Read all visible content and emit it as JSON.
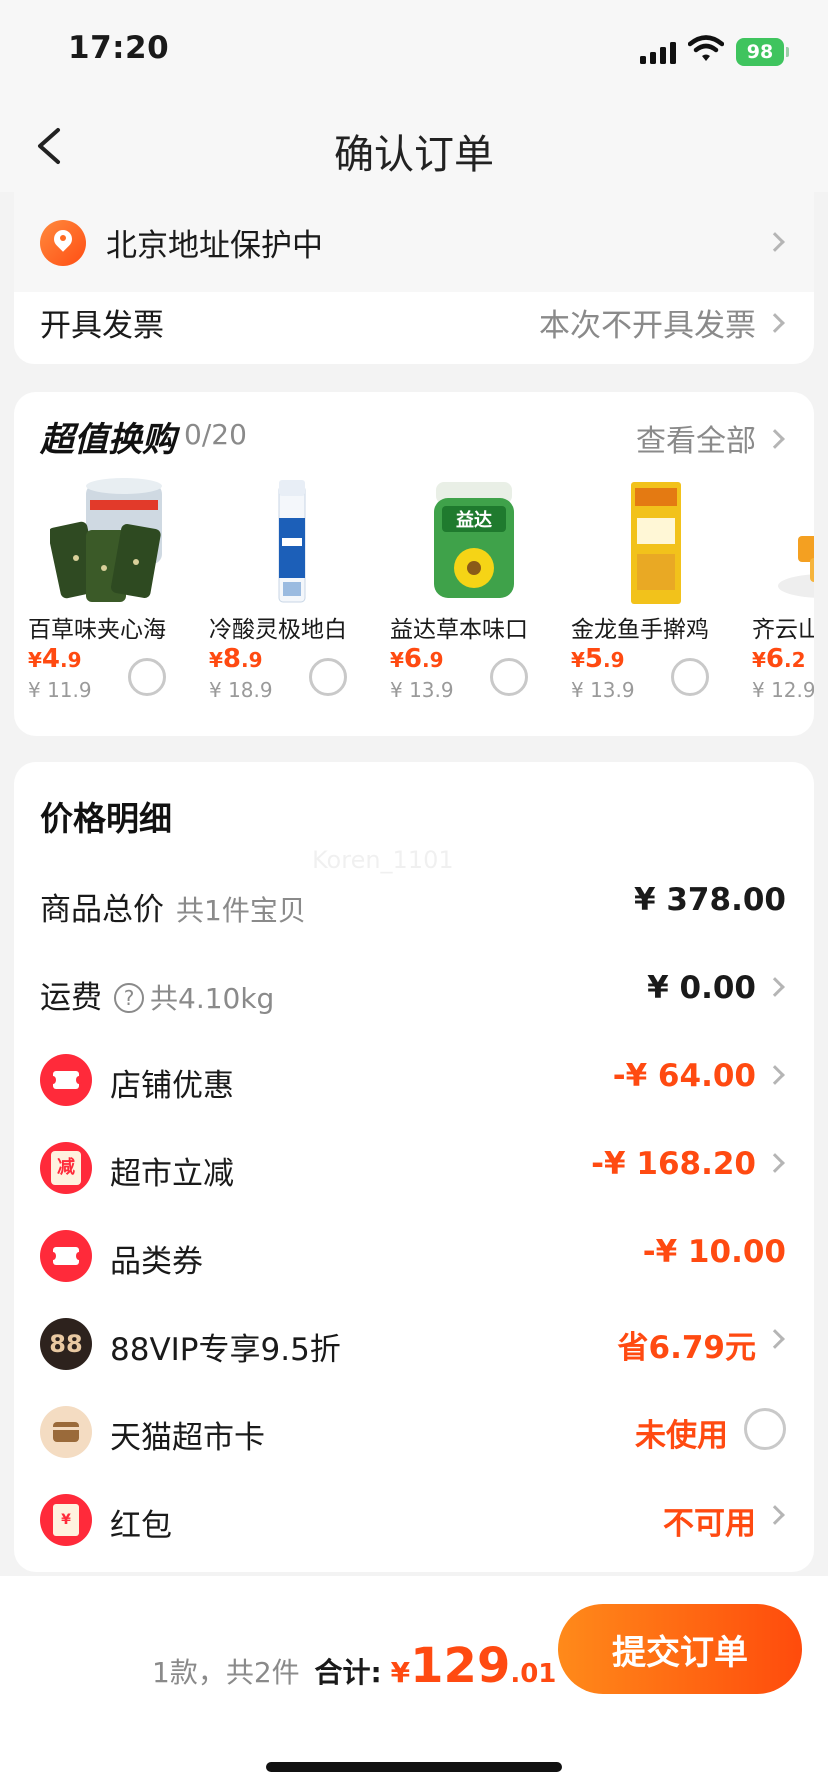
{
  "status_bar": {
    "time": "17:20",
    "battery": "98"
  },
  "nav": {
    "title": "确认订单"
  },
  "address": {
    "text": "北京地址保护中"
  },
  "invoice": {
    "label": "开具发票",
    "value": "本次不开具发票"
  },
  "bargain": {
    "title": "超值换购",
    "count": "0/20",
    "view_all": "查看全部",
    "items": [
      {
        "name": "百草味夹心海",
        "price_int": "4",
        "price_dec": ".9",
        "orig": "¥ 11.9",
        "image": "seaweed-can"
      },
      {
        "name": "冷酸灵极地白",
        "price_int": "8",
        "price_dec": ".9",
        "orig": "¥ 18.9",
        "image": "toothpaste"
      },
      {
        "name": "益达草本味口",
        "price_int": "6",
        "price_dec": ".9",
        "orig": "¥ 13.9",
        "image": "gum-bottle"
      },
      {
        "name": "金龙鱼手擀鸡",
        "price_int": "5",
        "price_dec": ".9",
        "orig": "¥ 13.9",
        "image": "noodle-pack"
      },
      {
        "name": "齐云山",
        "price_int": "6",
        "price_dec": ".2",
        "orig": "¥ 12.9",
        "image": "candy"
      }
    ]
  },
  "details": {
    "title": "价格明细",
    "goods_total": {
      "label": "商品总价",
      "sub": "共1件宝贝",
      "value": "¥ 378.00"
    },
    "shipping": {
      "label": "运费",
      "sub": "共4.10kg",
      "value": "¥ 0.00"
    },
    "shop_discount": {
      "label": "店铺优惠",
      "value": "-¥ 64.00"
    },
    "market_cut": {
      "label": "超市立减",
      "icon_text": "减",
      "value": "-¥ 168.20"
    },
    "category_coupon": {
      "label": "品类券",
      "value": "-¥ 10.00"
    },
    "vip": {
      "label": "88VIP专享9.5折",
      "icon_text": "88",
      "value": "省6.79元"
    },
    "market_card": {
      "label": "天猫超市卡",
      "value": "未使用"
    },
    "red_packet": {
      "label": "红包",
      "icon_text": "¥",
      "value": "不可用"
    }
  },
  "watermark": "Koren_1101",
  "bottom": {
    "summary": "1款，共2件",
    "total_label": "合计:",
    "currency": "¥",
    "total_int": "129",
    "total_dec": ".01",
    "submit": "提交订单"
  },
  "colors": {
    "accent": "#ff4a11",
    "brand_orange": "#ff6a22",
    "coupon_red": "#ff2a3a"
  }
}
